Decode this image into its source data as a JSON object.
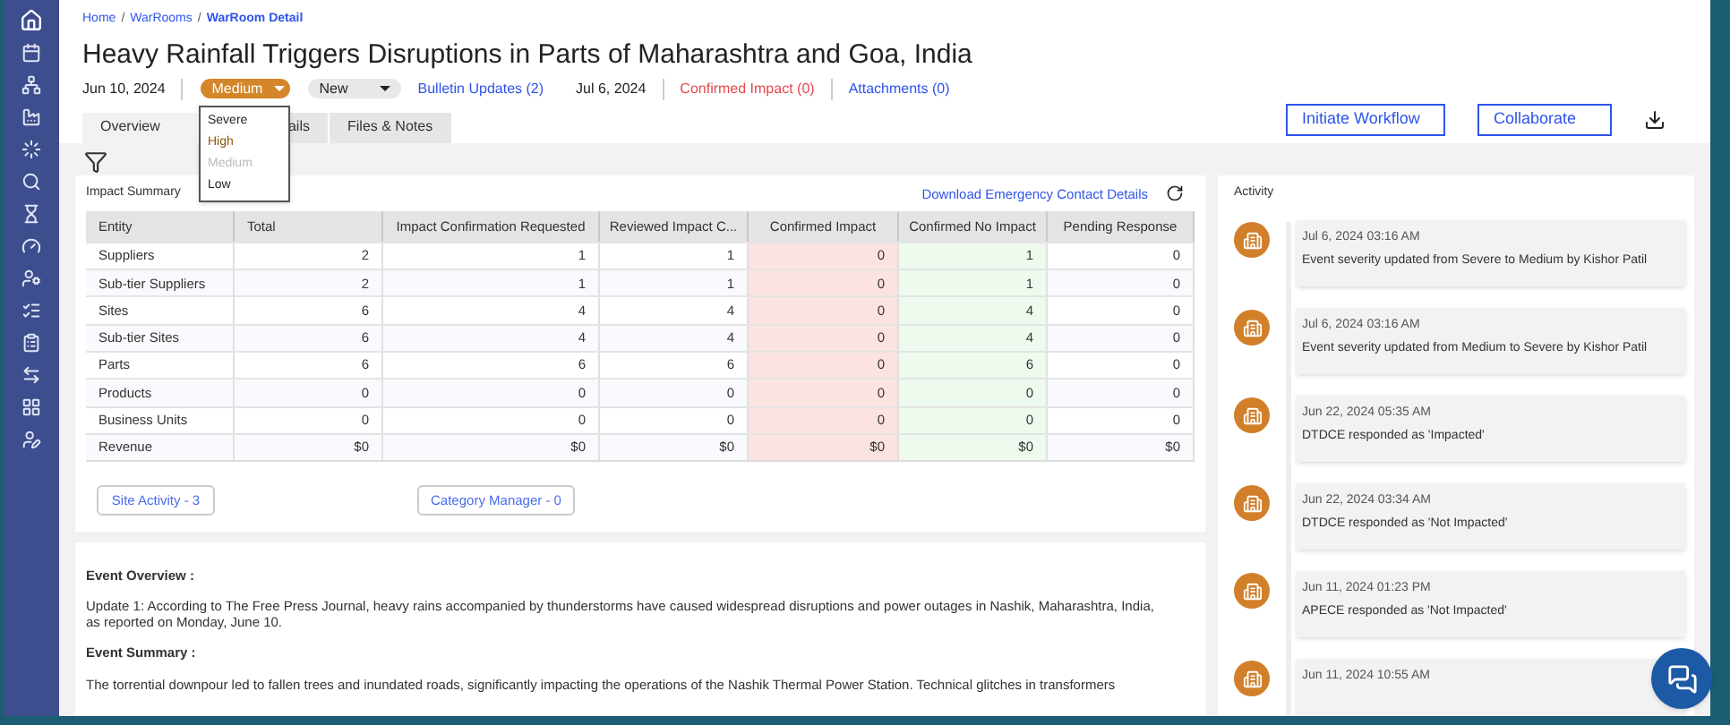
{
  "sidebar": {
    "items": [
      {
        "selected": true
      },
      {
        "selected": false
      },
      {
        "selected": false
      },
      {
        "selected": false
      },
      {
        "selected": false
      },
      {
        "selected": false
      },
      {
        "selected": false
      },
      {
        "selected": false
      },
      {
        "selected": false
      },
      {
        "selected": false
      },
      {
        "selected": false
      },
      {
        "selected": false
      },
      {
        "selected": false
      },
      {
        "selected": false
      }
    ]
  },
  "breadcrumb": [
    {
      "kind": "link",
      "text": "Home"
    },
    {
      "kind": "separator",
      "text": "/"
    },
    {
      "kind": "link",
      "text": "WarRooms"
    },
    {
      "kind": "separator",
      "text": "/"
    },
    {
      "kind": "current",
      "text": "WarRoom Detail"
    }
  ],
  "title": "Heavy Rainfall Triggers Disruptions in Parts of Maharashtra and Goa, India",
  "meta": {
    "date": "Jun 10, 2024",
    "severity": {
      "value": "Medium",
      "expanded": true,
      "options": [
        {
          "label": "Severe",
          "selected": false
        },
        {
          "label": "High",
          "selected": false
        },
        {
          "label": "Medium",
          "selected": true
        },
        {
          "label": "Low",
          "selected": false
        }
      ]
    },
    "status": "New",
    "items": [
      {
        "kind": "link",
        "text": "Bulletin Updates (2)",
        "color": "#2f54eb"
      },
      {
        "kind": "text",
        "text": "Jul 6, 2024",
        "color": "#222222"
      },
      {
        "kind": "link",
        "text": "Confirmed Impact (0)",
        "color": "#e5484d"
      },
      {
        "kind": "link",
        "text": "Attachments (0)",
        "color": "#2f54eb"
      }
    ]
  },
  "tabs": [
    {
      "label": "Overview",
      "selected": true
    },
    {
      "label": "ails",
      "selected": false
    },
    {
      "label": "Files & Notes",
      "selected": false
    }
  ],
  "actions": [
    "Initiate Workflow",
    "Collaborate"
  ],
  "impact_summary": {
    "title": "Impact Summary",
    "download_link": "Download Emergency Contact Details",
    "columns": [
      {
        "label": "Entity"
      },
      {
        "label": "Total"
      },
      {
        "label": "Impact Confirmation Requested"
      },
      {
        "label": "Reviewed Impact C..."
      },
      {
        "label": "Confirmed Impact",
        "color": "#fae3e1"
      },
      {
        "label": "Confirmed No Impact",
        "color": "#effaee"
      },
      {
        "label": "Pending Response"
      }
    ],
    "rows": [
      [
        "Suppliers",
        "2",
        "1",
        "1",
        "0",
        "1",
        "0"
      ],
      [
        "Sub-tier Suppliers",
        "2",
        "1",
        "1",
        "0",
        "1",
        "0"
      ],
      [
        "Sites",
        "6",
        "4",
        "4",
        "0",
        "4",
        "0"
      ],
      [
        "Sub-tier Sites",
        "6",
        "4",
        "4",
        "0",
        "4",
        "0"
      ],
      [
        "Parts",
        "6",
        "6",
        "6",
        "0",
        "6",
        "0"
      ],
      [
        "Products",
        "0",
        "0",
        "0",
        "0",
        "0",
        "0"
      ],
      [
        "Business Units",
        "0",
        "0",
        "0",
        "0",
        "0",
        "0"
      ],
      [
        "Revenue",
        "$0",
        "$0",
        "$0",
        "$0",
        "$0",
        "$0"
      ]
    ],
    "buttons": [
      "Site Activity - 3",
      "Category Manager - 0"
    ]
  },
  "event": {
    "sections": [
      {
        "heading": "Event Overview :",
        "text": "Update 1: According to The Free Press Journal, heavy rains accompanied by thunderstorms have caused widespread disruptions and power outages in Nashik, Maharashtra, India, as reported on Monday, June 10."
      },
      {
        "heading": "Event Summary :",
        "text": "The torrential downpour led to fallen trees and inundated roads, significantly impacting the operations of the Nashik Thermal Power Station. Technical glitches in transformers"
      }
    ]
  },
  "activity": {
    "title": "Activity",
    "items": [
      {
        "time": "Jul 6, 2024 03:16 AM",
        "text": "Event severity updated from Severe to Medium by Kishor Patil"
      },
      {
        "time": "Jul 6, 2024 03:16 AM",
        "text": "Event severity updated from Medium to Severe by Kishor Patil"
      },
      {
        "time": "Jun 22, 2024 05:35 AM",
        "text": "DTDCE responded as 'Impacted'"
      },
      {
        "time": "Jun 22, 2024 03:34 AM",
        "text": "DTDCE responded as 'Not Impacted'"
      },
      {
        "time": "Jun 11, 2024 01:23 PM",
        "text": "APECE responded as 'Not Impacted'"
      },
      {
        "time": "Jun 11, 2024 10:55 AM"
      }
    ]
  }
}
